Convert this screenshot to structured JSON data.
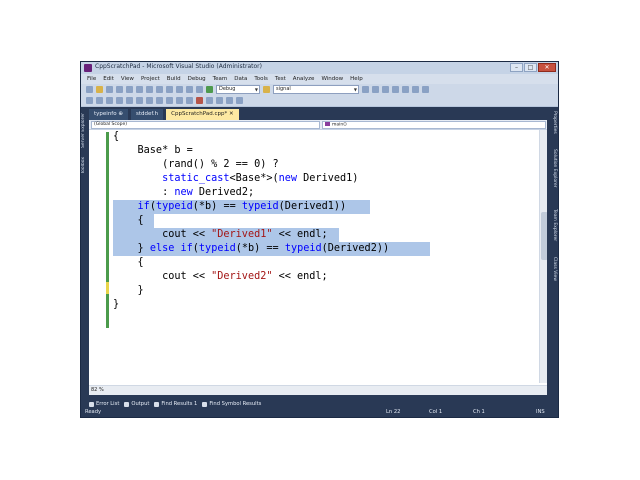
{
  "window": {
    "title": "CppScratchPad - Microsoft Visual Studio (Administrator)"
  },
  "menu": [
    "File",
    "Edit",
    "View",
    "Project",
    "Build",
    "Debug",
    "Team",
    "Data",
    "Tools",
    "Test",
    "Analyze",
    "Window",
    "Help"
  ],
  "toolbar": {
    "config": "Debug",
    "find": "signal"
  },
  "tabs": [
    {
      "label": "typeinfo"
    },
    {
      "label": "stddef.h"
    },
    {
      "label": "CppScratchPad.cpp*"
    }
  ],
  "left_panels": [
    "Server Explorer",
    "Toolbox"
  ],
  "right_panels": [
    "Properties",
    "Solution Explorer",
    "Team Explorer",
    "Class View"
  ],
  "navbar": {
    "scope": "(Global Scope)",
    "member": "main()"
  },
  "code_lines": [
    "{",
    "    Base* b =",
    "        (rand() % 2 == 0) ?",
    "        static_cast<Base*>(new Derived1)",
    "        : new Derived2;",
    "    if(typeid(*b) == typeid(Derived1))",
    "    {",
    "        cout << \"Derived1\" << endl;",
    "    } else if(typeid(*b) == typeid(Derived2))",
    "    {",
    "        cout << \"Derived2\" << endl;",
    "    }",
    "}"
  ],
  "zoom": "82 %",
  "bottom_tabs": [
    "Error List",
    "Output",
    "Find Results 1",
    "Find Symbol Results"
  ],
  "status": {
    "state": "Ready",
    "line": "Ln 22",
    "col": "Col 1",
    "ch": "Ch 1",
    "mode": "INS"
  }
}
